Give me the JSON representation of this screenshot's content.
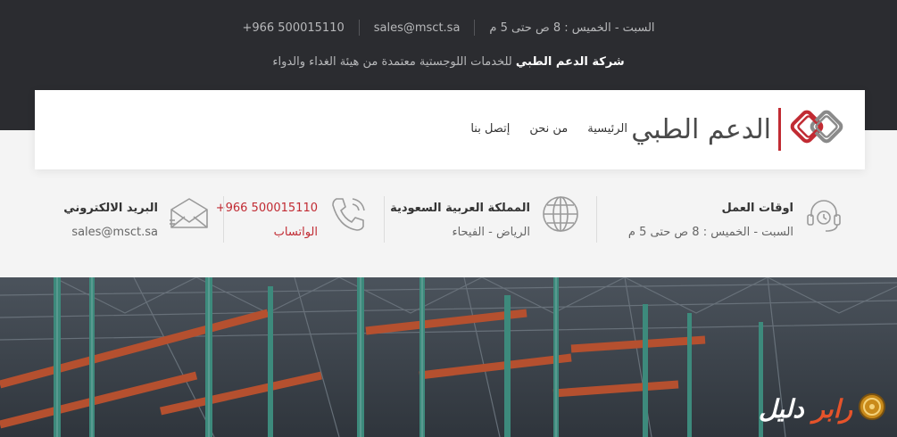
{
  "topbar": {
    "hours": "السبت - الخميس : 8 ص حتى 5 م",
    "email": "sales@msct.sa",
    "phone": "+966 500015110",
    "tagline_bold": "شركة الدعم الطبي",
    "tagline_rest": " للخدمات اللوجستية معتمدة من هيئة الغداء والدواء"
  },
  "header": {
    "logo_text": "الدعم الطبي",
    "nav": [
      "الرئيسية",
      "من نحن",
      "إتصل بنا"
    ]
  },
  "info": {
    "hours_title": "اوقات العمل",
    "hours_value": "السبت - الخميس : 8 ص حتى 5 م",
    "location_title": "المملكة العربية السعودية",
    "location_value": "الرياض - الفيحاء",
    "phone_title": "+966 500015110",
    "phone_value": "الواتساب",
    "email_title": "البريد الالكتروني",
    "email_value": "sales@msct.sa"
  },
  "watermark": {
    "part_a": "رابر",
    "part_b": "دليل"
  },
  "colors": {
    "brand_red": "#c12b33",
    "topbar_bg": "#2b2c30"
  },
  "icons": [
    "logo-icon",
    "headset-icon",
    "globe-icon",
    "phone-icon",
    "mail-icon",
    "coin-icon"
  ]
}
